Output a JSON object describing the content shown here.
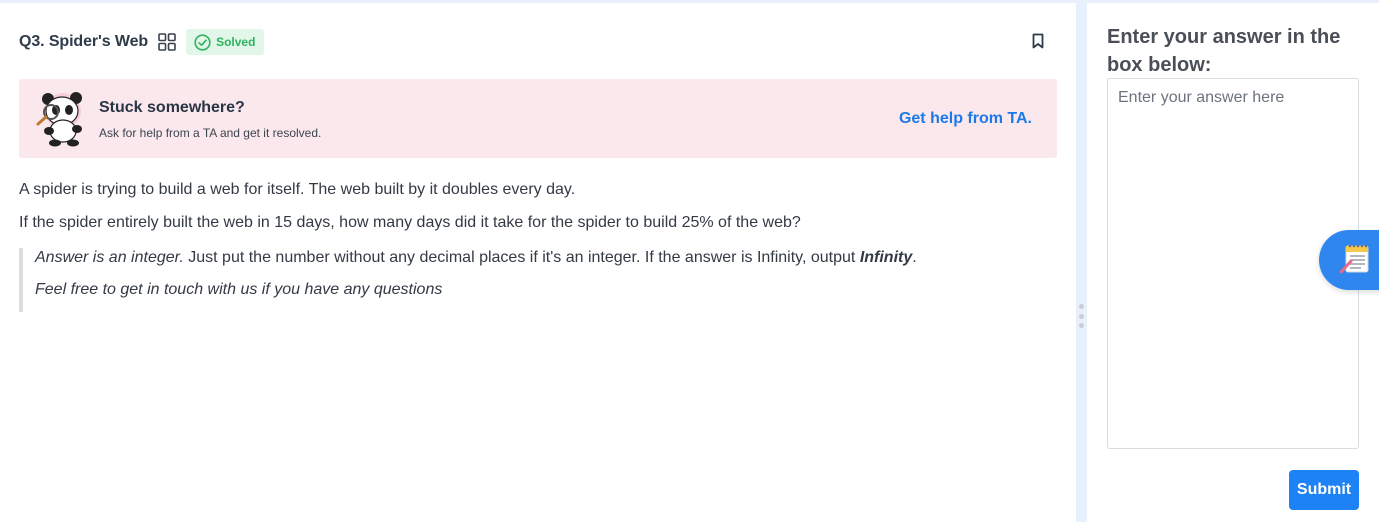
{
  "question": {
    "title": "Q3. Spider's Web",
    "status": "Solved",
    "body_lines": [
      "A spider is trying to build a web for itself. The web built by it doubles every day.",
      "If the spider entirely built the web in 15 days, how many days did it take for the spider to build 25% of the web?"
    ],
    "note": {
      "italic_lead": "Answer is an integer.",
      "text": " Just put the number without any decimal places if it's an integer. If the answer is Infinity, output ",
      "bold_term": "Infinity",
      "end": ".",
      "line2": "Feel free to get in touch with us if you have any questions"
    }
  },
  "help": {
    "title": "Stuck somewhere?",
    "subtitle": "Ask for help from a TA and get it resolved.",
    "link_label": "Get help from TA."
  },
  "answer": {
    "prompt": "Enter your answer in the box below:",
    "placeholder": "Enter your answer here",
    "submit_label": "Submit"
  },
  "icons": {
    "grid": "grid-icon",
    "solved": "check-circle-icon",
    "bookmark": "bookmark-icon",
    "mascot": "panda-mascot",
    "notes": "notepad-icon"
  },
  "colors": {
    "accent": "#1d82f5",
    "link": "#1d79e8",
    "solved_green": "#2db35c",
    "help_bg": "#fbe8ec",
    "splitter": "#e8f0fb"
  }
}
